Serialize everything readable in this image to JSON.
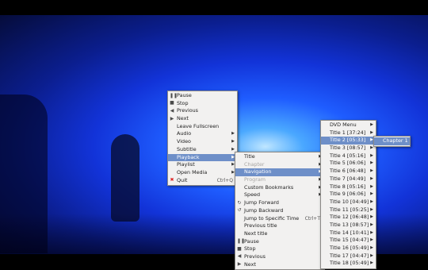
{
  "main_menu": [
    {
      "label": "Pause",
      "icon": "pause-icon"
    },
    {
      "label": "Stop",
      "icon": "stop-icon"
    },
    {
      "label": "Previous",
      "icon": "previous-icon"
    },
    {
      "label": "Next",
      "icon": "next-icon"
    },
    {
      "label": "Leave Fullscreen",
      "icon": ""
    },
    {
      "label": "Audio",
      "submenu": true
    },
    {
      "label": "Video",
      "submenu": true
    },
    {
      "label": "Subtitle",
      "submenu": true
    },
    {
      "label": "Playback",
      "submenu": true,
      "highlight": true
    },
    {
      "label": "Playlist",
      "submenu": true
    },
    {
      "label": "Open Media",
      "submenu": true
    },
    {
      "label": "Quit",
      "icon": "quit-icon",
      "shortcut": "Ctrl+Q"
    }
  ],
  "playback_menu": [
    {
      "label": "Title",
      "submenu": true
    },
    {
      "label": "Chapter",
      "submenu": true,
      "disabled": true
    },
    {
      "label": "Navigation",
      "submenu": true,
      "highlight": true
    },
    {
      "label": "Program",
      "submenu": true,
      "disabled": true
    },
    {
      "label": "Custom Bookmarks",
      "submenu": true
    },
    {
      "label": "Speed",
      "submenu": true
    },
    {
      "label": "Jump Forward",
      "icon": "jump-forward-icon"
    },
    {
      "label": "Jump Backward",
      "icon": "jump-backward-icon"
    },
    {
      "label": "Jump to Specific Time",
      "shortcut": "Ctrl+T"
    },
    {
      "label": "Previous title"
    },
    {
      "label": "Next title"
    },
    {
      "label": "Pause",
      "icon": "pause-icon"
    },
    {
      "label": "Stop",
      "icon": "stop-icon"
    },
    {
      "label": "Previous",
      "icon": "previous-icon"
    },
    {
      "label": "Next",
      "icon": "next-icon"
    }
  ],
  "navigation_menu": [
    {
      "label": "DVD Menu",
      "submenu": true
    },
    {
      "label": "Title 1 [37:24]",
      "submenu": true
    },
    {
      "label": "Title 2 [05:33]",
      "submenu": true,
      "highlight": true
    },
    {
      "label": "Title 3 [08:57]",
      "submenu": true
    },
    {
      "label": "Title 4 [05:16]",
      "submenu": true
    },
    {
      "label": "Title 5 [06:06]",
      "submenu": true
    },
    {
      "label": "Title 6 [06:48]",
      "submenu": true
    },
    {
      "label": "Title 7 [04:49]",
      "submenu": true
    },
    {
      "label": "Title 8 [05:16]",
      "submenu": true
    },
    {
      "label": "Title 9 [06:06]",
      "submenu": true
    },
    {
      "label": "Title 10 [04:49]",
      "submenu": true
    },
    {
      "label": "Title 11 [05:25]",
      "submenu": true
    },
    {
      "label": "Title 12 [06:48]",
      "submenu": true
    },
    {
      "label": "Title 13 [08:57]",
      "submenu": true
    },
    {
      "label": "Title 14 [10:41]",
      "submenu": true
    },
    {
      "label": "Title 15 [04:47]",
      "submenu": true
    },
    {
      "label": "Title 16 [05:49]",
      "submenu": true
    },
    {
      "label": "Title 17 [04:47]",
      "submenu": true
    },
    {
      "label": "Title 18 [05:49]",
      "submenu": true
    }
  ],
  "chapter_menu": [
    {
      "label": "Chapter 1",
      "highlight": true
    }
  ],
  "colors": {
    "highlight": "#6e8fc8",
    "menu_bg": "#f2f1f0"
  }
}
